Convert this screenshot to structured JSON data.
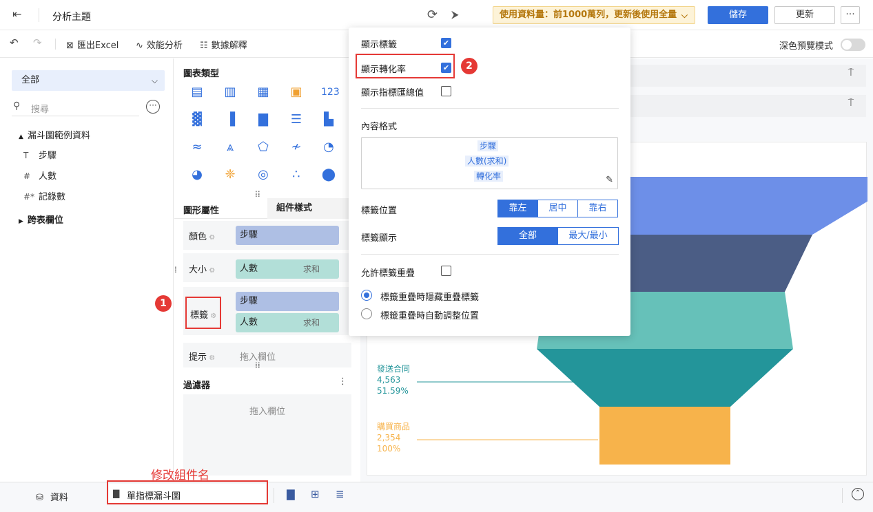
{
  "header": {
    "title": "分析主題",
    "data_banner": "使用資料量：前1000萬列，更新後使用全量",
    "save_label": "儲存",
    "update_label": "更新",
    "more_label": "···"
  },
  "toolbar": {
    "export_label": "匯出Excel",
    "perf_label": "效能分析",
    "explain_label": "數據解釋",
    "dark_mode_label": "深色預覽模式",
    "dark_mode_on": false
  },
  "left_panel": {
    "scope": "全部",
    "search_placeholder": "搜尋",
    "dataset": "漏斗圖範例資料",
    "fields": [
      {
        "type": "T",
        "name": "步驟"
      },
      {
        "type": "#",
        "name": "人數"
      },
      {
        "type": "#*",
        "name": "記錄數"
      }
    ],
    "cross_table": "跨表欄位"
  },
  "middle_panel": {
    "chart_type_label": "圖表類型",
    "tab_props": "圖形屬性",
    "tab_style": "組件樣式",
    "color_label": "顏色",
    "color_field": "步驟",
    "size_label": "大小",
    "size_field": "人數",
    "size_agg": "求和",
    "label_label": "標籤",
    "label_field_1": "步驟",
    "label_field_2": "人數",
    "label_field_2_agg": "求和",
    "tooltip_label": "提示",
    "tooltip_placeholder": "拖入欄位",
    "filter_label": "過濾器",
    "filter_placeholder": "拖入欄位"
  },
  "popup": {
    "show_label": "顯示標籤",
    "show_label_checked": true,
    "show_conversion": "顯示轉化率",
    "show_conversion_checked": true,
    "show_total": "顯示指標匯總值",
    "show_total_checked": false,
    "content_format": "內容格式",
    "format_tags": [
      "步驟",
      "人數(求和)",
      "轉化率"
    ],
    "label_position": "標籤位置",
    "position_options": [
      "靠左",
      "居中",
      "靠右"
    ],
    "position_selected": "靠左",
    "label_display": "標籤顯示",
    "display_options": [
      "全部",
      "最大/最小"
    ],
    "display_selected": "全部",
    "allow_overlap": "允許標籤重疊",
    "allow_overlap_checked": false,
    "overlap_options": [
      "標籤重疊時隱藏重疊標籤",
      "標籤重疊時自動調整位置"
    ],
    "overlap_selected": 0
  },
  "annotations": {
    "badge_1": "1",
    "badge_2": "2",
    "rename_note": "修改組件名"
  },
  "bottom_bar": {
    "data_tab": "資料",
    "widget_name": "單指標漏斗圖"
  },
  "chart_data": {
    "type": "funnel",
    "series_colors": [
      "#6d8fe8",
      "#4b5d85",
      "#66c1b9",
      "#23959a",
      "#f7b34b"
    ],
    "stages": [
      {
        "label": "",
        "value": null,
        "percent": null
      },
      {
        "label": "",
        "value": null,
        "percent": null
      },
      {
        "label": "",
        "value": null,
        "percent": null
      },
      {
        "label": "發送合同",
        "value": "4,563",
        "percent": "51.59%"
      },
      {
        "label": "購買商品",
        "value": "2,354",
        "percent": "100%"
      }
    ]
  }
}
